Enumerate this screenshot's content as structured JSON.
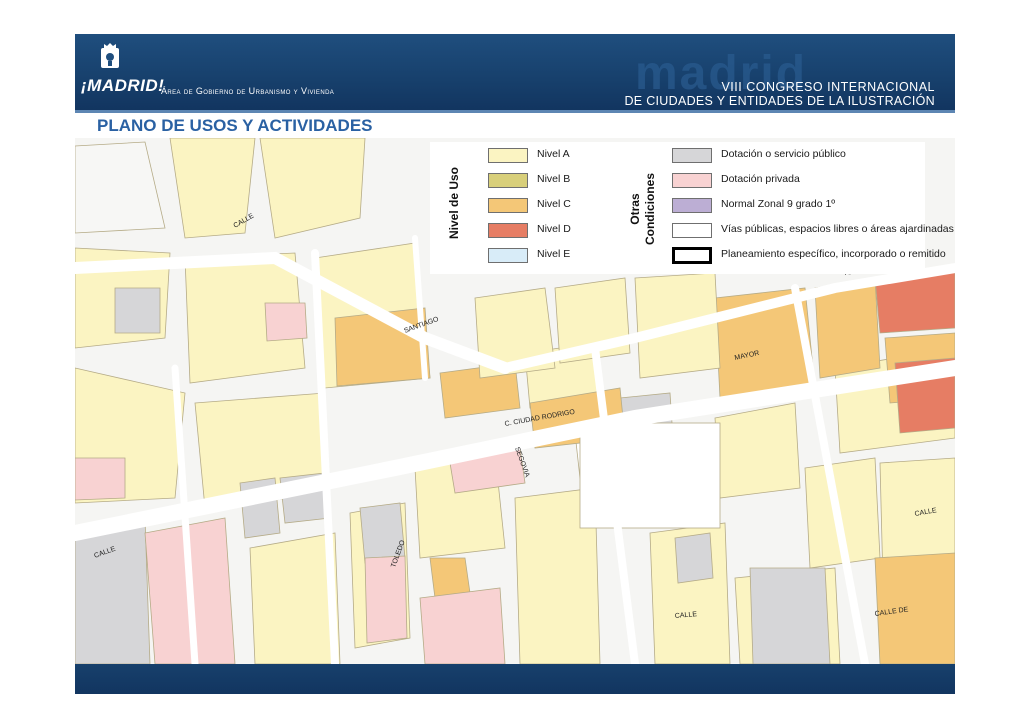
{
  "header": {
    "logo_text": "¡MADRID!",
    "area_text": "Área de Gobierno de Urbanismo y Vivienda",
    "watermark_text": "madrid",
    "congress_line1": "VIII CONGRESO INTERNACIONAL",
    "congress_line2": "DE CIUDADES Y ENTIDADES DE LA ILUSTRACIÓN"
  },
  "title": "PLANO DE USOS Y ACTIVIDADES",
  "legend": {
    "nivel_heading": "Nivel de Uso",
    "otras_heading_1": "Otras",
    "otras_heading_2": "Condiciones",
    "nivel_items": [
      {
        "label": "Nivel A",
        "color": "#fbf4c2"
      },
      {
        "label": "Nivel B",
        "color": "#d8cf7a"
      },
      {
        "label": "Nivel C",
        "color": "#f4c777"
      },
      {
        "label": "Nivel D",
        "color": "#e67d64"
      },
      {
        "label": "Nivel E",
        "color": "#d8ecf8"
      }
    ],
    "otras_items": [
      {
        "label": "Dotación o servicio público",
        "color": "#d6d6d8"
      },
      {
        "label": "Dotación privada",
        "color": "#f8d2d2"
      },
      {
        "label": "Normal Zonal 9 grado 1º",
        "color": "#bcaed4"
      },
      {
        "label": "Vías públicas, espacios libres o áreas ajardinadas",
        "color": "#ffffff"
      },
      {
        "label": "Planeamiento específico, incorporado o remitido",
        "color": "#ffffff"
      }
    ]
  },
  "map": {
    "street_labels": [
      "MAYOR",
      "C. CIUDAD RODRIGO",
      "CALLE",
      "CALLE",
      "CALLE",
      "SANTIAGO",
      "CALLE",
      "SEGOVIA",
      "ARENAL",
      "TOLEDO",
      "CALLE DE"
    ]
  }
}
